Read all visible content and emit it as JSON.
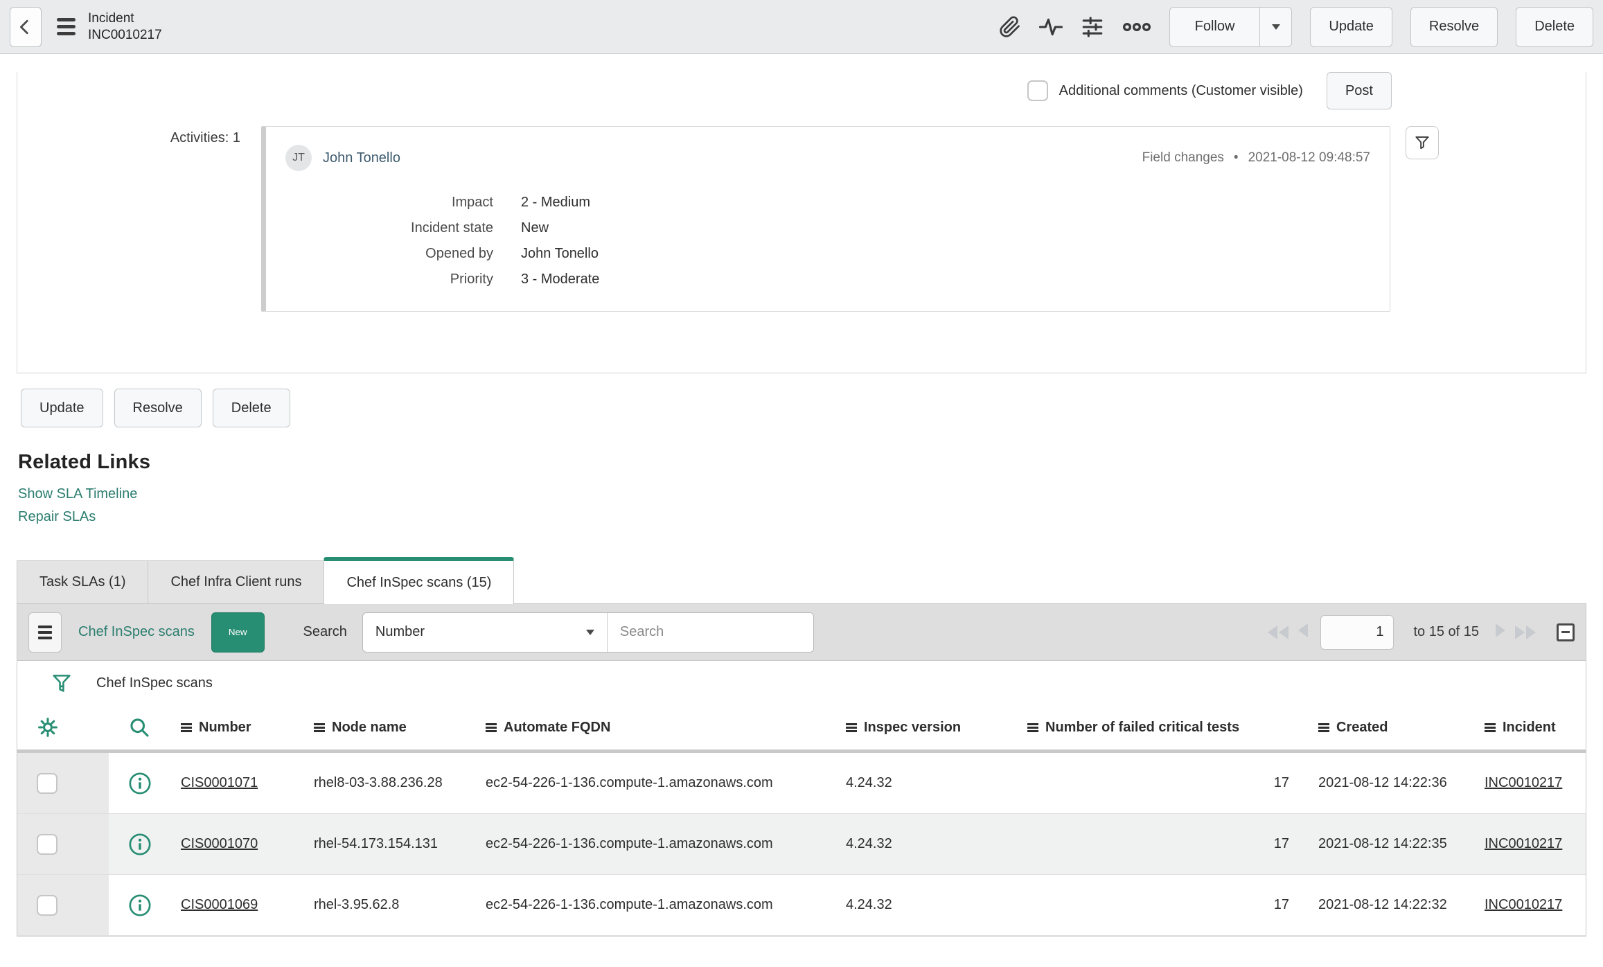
{
  "colors": {
    "accent_teal": "#278e73",
    "link_teal": "#2b7d6f"
  },
  "header": {
    "title_line1": "Incident",
    "title_line2": "INC0010217",
    "follow": "Follow",
    "update": "Update",
    "resolve": "Resolve",
    "delete": "Delete"
  },
  "comments": {
    "label": "Additional comments (Customer visible)",
    "post": "Post"
  },
  "activities": {
    "count_label": "Activities: 1",
    "entry": {
      "initials": "JT",
      "user": "John Tonello",
      "change_type": "Field changes",
      "separator": "•",
      "timestamp": "2021-08-12 09:48:57",
      "fields": [
        {
          "label": "Impact",
          "value": "2 - Medium"
        },
        {
          "label": "Incident state",
          "value": "New"
        },
        {
          "label": "Opened by",
          "value": "John Tonello"
        },
        {
          "label": "Priority",
          "value": "3 - Moderate"
        }
      ]
    }
  },
  "form_actions": {
    "update": "Update",
    "resolve": "Resolve",
    "delete": "Delete"
  },
  "related_links": {
    "title": "Related Links",
    "links": [
      {
        "label": "Show SLA Timeline"
      },
      {
        "label": "Repair SLAs"
      }
    ]
  },
  "tabs": [
    {
      "label": "Task SLAs (1)"
    },
    {
      "label": "Chef Infra Client runs"
    },
    {
      "label": "Chef InSpec scans (15)"
    }
  ],
  "list": {
    "title": "Chef InSpec scans",
    "new_button": "New",
    "search_label": "Search",
    "search_field": "Number",
    "search_placeholder": "Search",
    "pagination": {
      "page": "1",
      "range": "to 15 of 15"
    },
    "breadcrumb": "Chef InSpec scans",
    "columns": [
      "Number",
      "Node name",
      "Automate FQDN",
      "Inspec version",
      "Number of failed critical tests",
      "Created",
      "Incident"
    ],
    "rows": [
      {
        "number": "CIS0001071",
        "node_name": "rhel8-03-3.88.236.28",
        "automate_fqdn": "ec2-54-226-1-136.compute-1.amazonaws.com",
        "inspec_version": "4.24.32",
        "failed_critical": "17",
        "created": "2021-08-12 14:22:36",
        "incident": "INC0010217"
      },
      {
        "number": "CIS0001070",
        "node_name": "rhel-54.173.154.131",
        "automate_fqdn": "ec2-54-226-1-136.compute-1.amazonaws.com",
        "inspec_version": "4.24.32",
        "failed_critical": "17",
        "created": "2021-08-12 14:22:35",
        "incident": "INC0010217"
      },
      {
        "number": "CIS0001069",
        "node_name": "rhel-3.95.62.8",
        "automate_fqdn": "ec2-54-226-1-136.compute-1.amazonaws.com",
        "inspec_version": "4.24.32",
        "failed_critical": "17",
        "created": "2021-08-12 14:22:32",
        "incident": "INC0010217"
      }
    ]
  }
}
